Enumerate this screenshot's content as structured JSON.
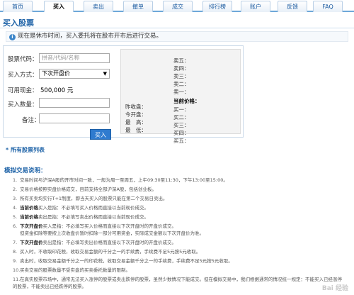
{
  "tabs": [
    {
      "label": "首页",
      "active": false
    },
    {
      "label": "买入",
      "active": true
    },
    {
      "label": "卖出",
      "active": false
    },
    {
      "label": "撤单",
      "active": false
    },
    {
      "label": "成交",
      "active": false
    },
    {
      "label": "排行榜",
      "active": false
    },
    {
      "label": "账户",
      "active": false
    },
    {
      "label": "反馈",
      "active": false
    },
    {
      "label": "FAQ",
      "active": false
    }
  ],
  "page_title": "买入股票",
  "notice": "现在是休市时间，买入委托将在股市开市后进行交易。",
  "form": {
    "code_label": "股票代码：",
    "code_placeholder": "拼音/代码/名称",
    "mode_label": "买入方式：",
    "mode_value": "下次开盘价",
    "cash_label": "可用现金：",
    "cash_value": "500,000 元",
    "qty_label": "买入数量：",
    "note_label": "备注：",
    "buy_button": "买入"
  },
  "quote": {
    "sell": [
      "卖五：",
      "卖四：",
      "卖三：",
      "卖二：",
      "卖一："
    ],
    "current": "当前价格：",
    "buy": [
      "买一：",
      "买二：",
      "买三：",
      "买四：",
      "买五："
    ],
    "left": [
      "昨收盘：",
      "今开盘：",
      "最　高：",
      "最　低："
    ]
  },
  "all_stocks_link": "* 所有股票列表",
  "rules_title": "模拟交易说明：",
  "rules": [
    {
      "n": "1.",
      "text": "交易时间与沪深A股的开市时间一致，一般为周一至周五，上午09:30至11:30，下午13:00至15:00。"
    },
    {
      "n": "2.",
      "text": "交易价格按照实盘价格成交，目前支持全部沪深A股，包括创业板。"
    },
    {
      "n": "3.",
      "text": "所有买卖均实行T+1制度，即当天买入的股票只能在第二个交易日卖出。"
    },
    {
      "n": "4.",
      "bold": "当前价格",
      "text": "买入是指：不必填写买入价格而直接以当前现价成交。"
    },
    {
      "n": "5.",
      "bold": "当前价格",
      "text": "卖出是指：不必填写卖出价格而直接以当前现价成交。"
    },
    {
      "n": "6.",
      "bold": "下次开盘价",
      "text": "买入是指：不必填写买入价格而直接以下次开盘时的开盘价成交。"
    },
    {
      "n": "",
      "text": "但资金扣除等要按上次收盘价暂时扣除一部分可用资金，实际成交金额以下次开盘价为准。"
    },
    {
      "n": "7.",
      "bold": "下次开盘价",
      "text": "卖出是指：不必填写卖出价格而直接以下次开盘时的开盘价成交。"
    },
    {
      "n": "8.",
      "text": "买入时，不收取印花税，收取交易金额的千分之一的手续费，手续费不足5元按5元收取。"
    },
    {
      "n": "9.",
      "text": "卖出时，收取交易金额千分之一的印花税，收取交易金额千分之一的手续费，手续费不足5元按5元收取。"
    },
    {
      "n": "10.",
      "text": "买卖交易的股票数量不受实盘的买卖委托数量的限制。"
    },
    {
      "n": "11.",
      "text": "在真实股票市场中，通常无法买入涨停的股票或卖出跌停的股票，虽然少数情况下能成交。但在模拟交易中，我们根据通常的情况统一规定：不能买入已经涨停的股票，不能卖出已经跌停的股票。"
    }
  ],
  "watermark": "Bai 经验"
}
